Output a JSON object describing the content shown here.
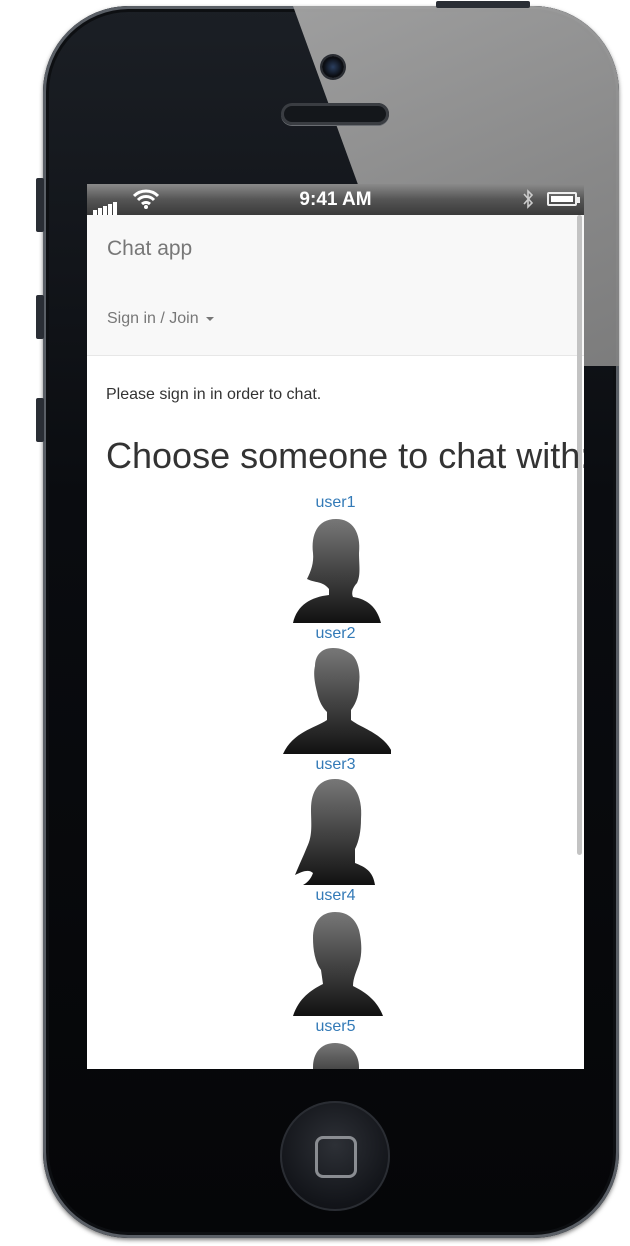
{
  "status_bar": {
    "time": "9:41 AM",
    "icons": [
      "signal-icon",
      "wifi-icon",
      "bluetooth-icon",
      "battery-icon"
    ]
  },
  "navbar": {
    "brand": "Chat app",
    "signin_label": "Sign in / Join"
  },
  "main": {
    "message": "Please sign in in order to chat.",
    "heading": "Choose someone to chat with:",
    "users": [
      {
        "name": "user1",
        "avatar": "female-silhouette-icon"
      },
      {
        "name": "user2",
        "avatar": "male-silhouette-icon"
      },
      {
        "name": "user3",
        "avatar": "female-long-hair-silhouette-icon"
      },
      {
        "name": "user4",
        "avatar": "male-silhouette-icon"
      },
      {
        "name": "user5",
        "avatar": "silhouette-icon"
      }
    ]
  },
  "colors": {
    "link": "#337ab7",
    "navbar_bg": "#f8f8f8",
    "text": "#333333"
  }
}
